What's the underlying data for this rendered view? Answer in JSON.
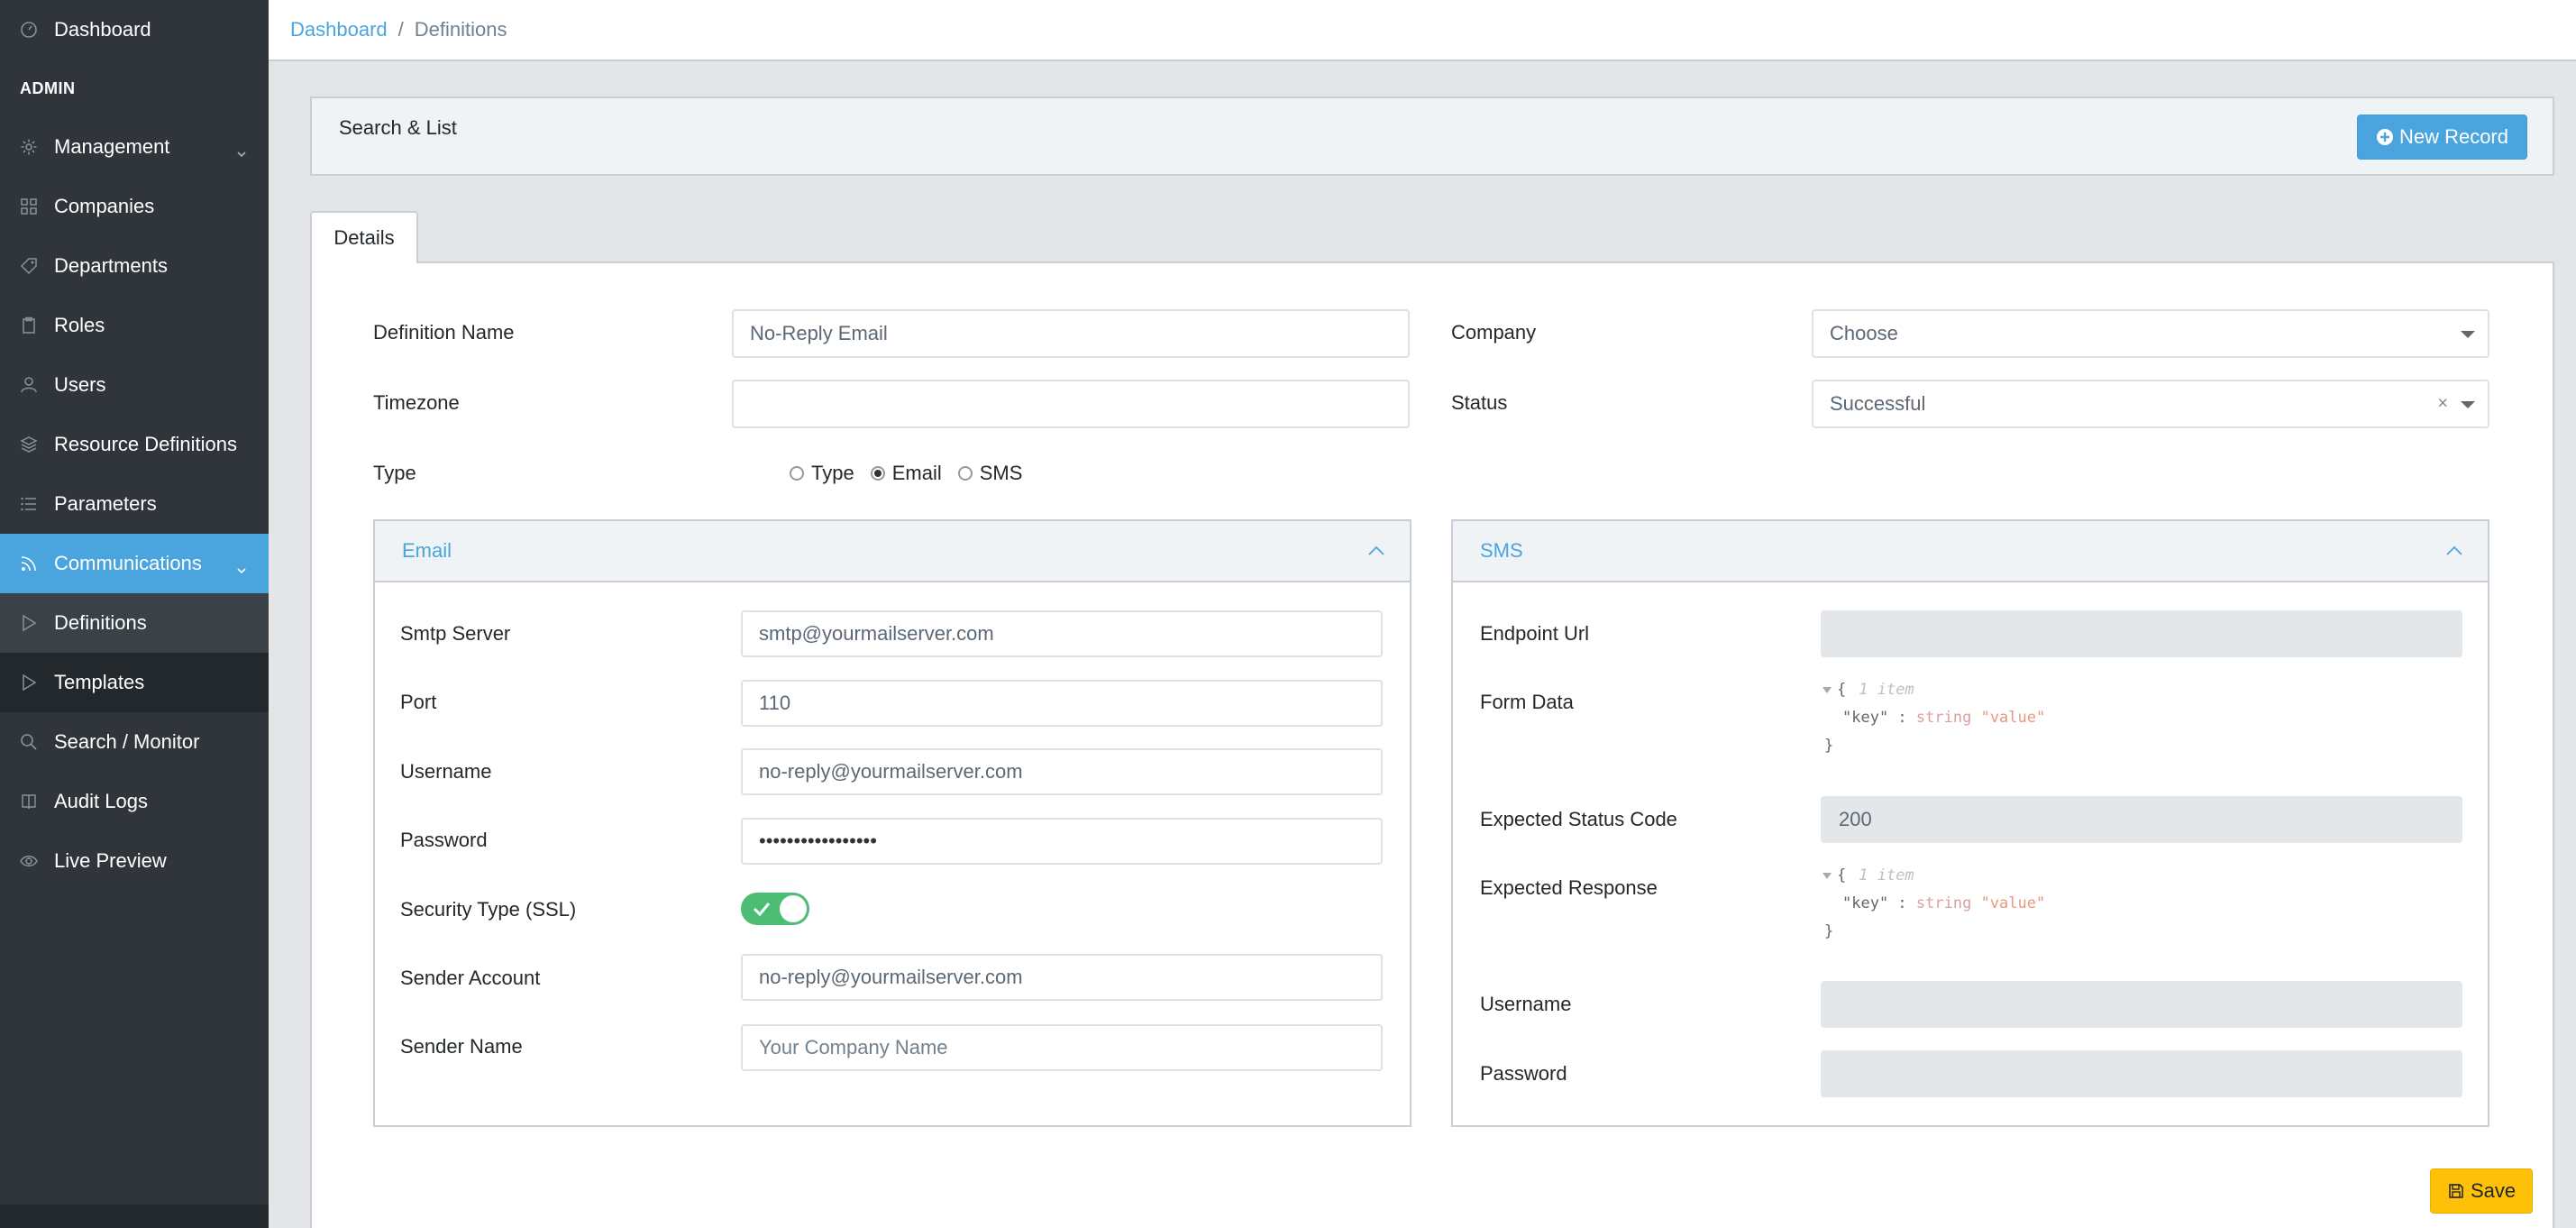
{
  "sidebar": {
    "dashboard": "Dashboard",
    "section_title": "ADMIN",
    "items": [
      {
        "label": "Management",
        "icon": "gear-icon"
      },
      {
        "label": "Companies",
        "icon": "grid-icon"
      },
      {
        "label": "Departments",
        "icon": "tag-icon"
      },
      {
        "label": "Roles",
        "icon": "clipboard-icon"
      },
      {
        "label": "Users",
        "icon": "user-icon"
      },
      {
        "label": "Resource Definitions",
        "icon": "layers-icon"
      },
      {
        "label": "Parameters",
        "icon": "list-icon"
      },
      {
        "label": "Communications",
        "icon": "rss-icon"
      }
    ],
    "sub_items": [
      {
        "label": "Definitions",
        "icon": "play-icon"
      },
      {
        "label": "Templates",
        "icon": "play-icon"
      },
      {
        "label": "Search / Monitor",
        "icon": "search-icon"
      },
      {
        "label": "Audit Logs",
        "icon": "book-icon"
      }
    ],
    "live_preview": "Live Preview"
  },
  "breadcrumb": {
    "link": "Dashboard",
    "separator": "/",
    "current": "Definitions"
  },
  "search_card": {
    "title": "Search & List",
    "new_record": "New Record"
  },
  "tabs": {
    "details": "Details"
  },
  "form": {
    "definition_name_label": "Definition Name",
    "definition_name_value": "No-Reply Email",
    "timezone_label": "Timezone",
    "timezone_value": "",
    "company_label": "Company",
    "company_value": "Choose",
    "status_label": "Status",
    "status_value": "Successful",
    "status_clear": "×",
    "type_label": "Type",
    "type_options": [
      "Type",
      "Email",
      "SMS"
    ],
    "type_selected": "Email"
  },
  "email": {
    "title": "Email",
    "smtp_server_label": "Smtp Server",
    "smtp_server_value": "smtp@yourmailserver.com",
    "port_label": "Port",
    "port_value": "110",
    "username_label": "Username",
    "username_value": "no-reply@yourmailserver.com",
    "password_label": "Password",
    "password_value": "•••••••••••••••••",
    "security_label": "Security Type (SSL)",
    "security_enabled": true,
    "sender_account_label": "Sender Account",
    "sender_account_value": "no-reply@yourmailserver.com",
    "sender_name_label": "Sender Name",
    "sender_name_placeholder": "Your Company Name"
  },
  "sms": {
    "title": "SMS",
    "endpoint_label": "Endpoint Url",
    "form_data_label": "Form Data",
    "expected_status_label": "Expected Status Code",
    "expected_status_value": "200",
    "expected_response_label": "Expected Response",
    "username_label": "Username",
    "password_label": "Password",
    "json_open": "{",
    "json_meta": "1 item",
    "json_key": "\"key\"",
    "json_colon": " : ",
    "json_type": "string",
    "json_value": "\"value\"",
    "json_close": "}"
  },
  "actions": {
    "save": "Save"
  },
  "colors": {
    "primary": "#4aa5de",
    "sidebar": "#2f353a",
    "success": "#4dbd74",
    "warning": "#ffc107"
  }
}
